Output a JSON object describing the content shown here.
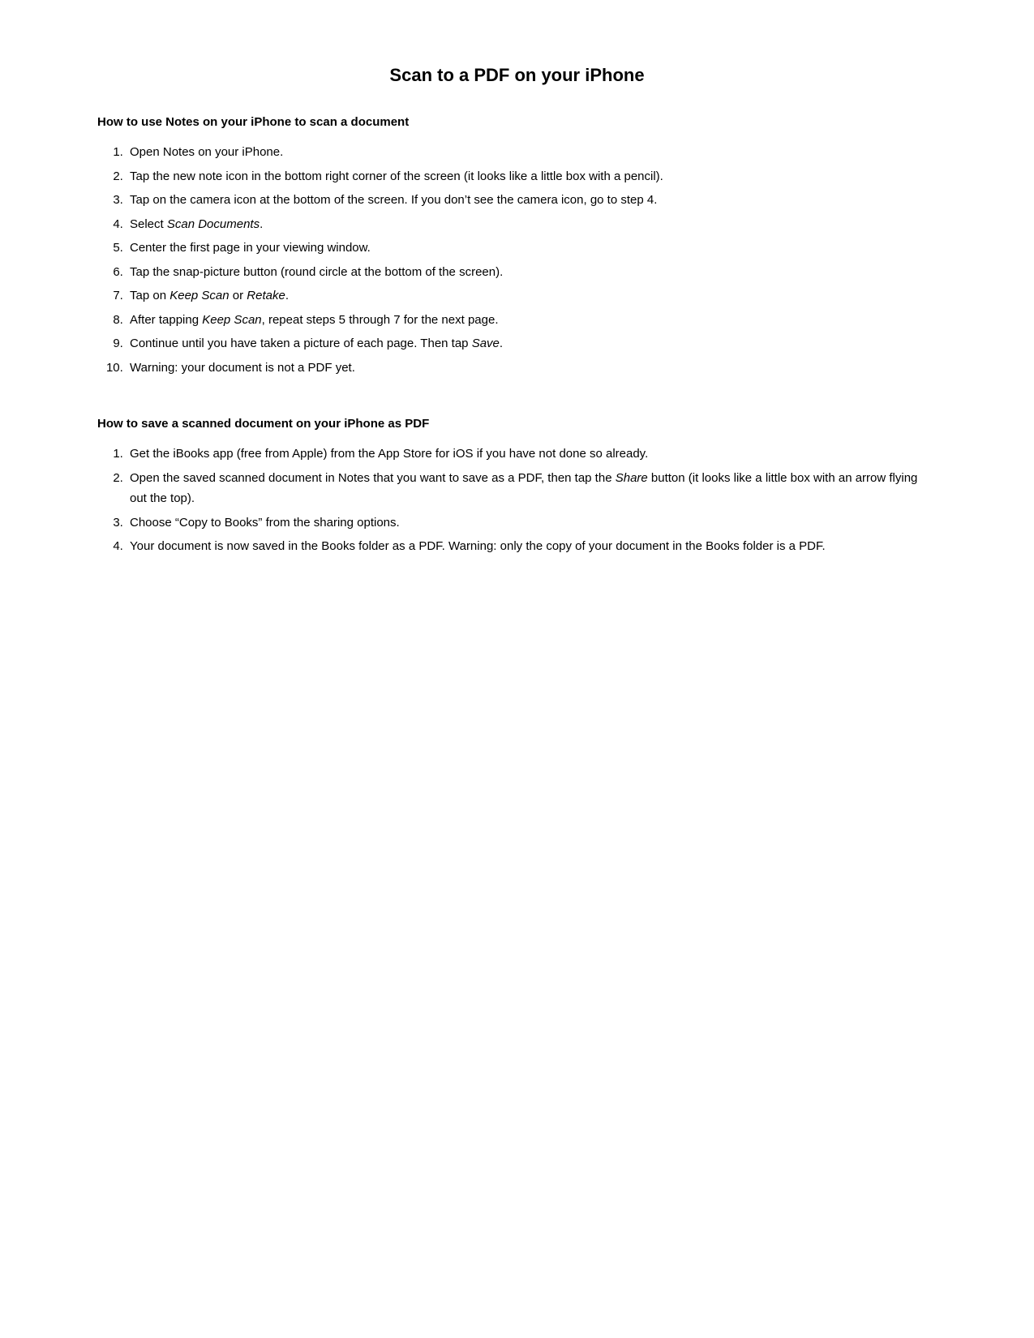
{
  "page": {
    "title": "Scan to a PDF on your iPhone",
    "section1": {
      "heading": "How to use Notes on your iPhone to scan a document",
      "steps": [
        {
          "id": 1,
          "parts": [
            {
              "text": "Open Notes on your iPhone.",
              "italic": false
            }
          ]
        },
        {
          "id": 2,
          "parts": [
            {
              "text": "Tap the new note icon in the bottom right corner of the screen (it looks like a little box with a pencil).",
              "italic": false
            }
          ]
        },
        {
          "id": 3,
          "parts": [
            {
              "text": "Tap on the camera icon at the bottom of the screen. If you don’t see the camera icon, go to step 4.",
              "italic": false
            }
          ]
        },
        {
          "id": 4,
          "parts": [
            {
              "text": "Select ",
              "italic": false
            },
            {
              "text": "Scan Documents",
              "italic": true
            },
            {
              "text": ".",
              "italic": false
            }
          ]
        },
        {
          "id": 5,
          "parts": [
            {
              "text": "Center the first page in your viewing window.",
              "italic": false
            }
          ]
        },
        {
          "id": 6,
          "parts": [
            {
              "text": "Tap the snap-picture button (round circle at the bottom of the screen).",
              "italic": false
            }
          ]
        },
        {
          "id": 7,
          "parts": [
            {
              "text": "Tap on ",
              "italic": false
            },
            {
              "text": "Keep Scan",
              "italic": true
            },
            {
              "text": " or ",
              "italic": false
            },
            {
              "text": "Retake",
              "italic": true
            },
            {
              "text": ".",
              "italic": false
            }
          ]
        },
        {
          "id": 8,
          "parts": [
            {
              "text": "After tapping ",
              "italic": false
            },
            {
              "text": "Keep Scan",
              "italic": true
            },
            {
              "text": ", repeat steps 5 through 7 for the next page.",
              "italic": false
            }
          ]
        },
        {
          "id": 9,
          "parts": [
            {
              "text": "Continue until you have taken a picture of each page. Then tap ",
              "italic": false
            },
            {
              "text": "Save",
              "italic": true
            },
            {
              "text": ".",
              "italic": false
            }
          ]
        },
        {
          "id": 10,
          "parts": [
            {
              "text": "Warning: your document is not a PDF yet.",
              "italic": false
            }
          ]
        }
      ]
    },
    "section2": {
      "heading": "How to save a scanned document on your iPhone as PDF",
      "steps": [
        {
          "id": 1,
          "parts": [
            {
              "text": "Get the iBooks app (free from Apple) from the App Store for iOS if you have not done so already.",
              "italic": false
            }
          ]
        },
        {
          "id": 2,
          "parts": [
            {
              "text": "Open the saved scanned document in Notes that you want to save as a PDF, then tap the ",
              "italic": false
            },
            {
              "text": "Share",
              "italic": true
            },
            {
              "text": " button (it looks like a little box with an arrow flying out the top).",
              "italic": false
            }
          ]
        },
        {
          "id": 3,
          "parts": [
            {
              "text": "Choose “Copy to Books” from the sharing options.",
              "italic": false
            }
          ]
        },
        {
          "id": 4,
          "parts": [
            {
              "text": "Your document is now saved in the Books folder as a PDF. Warning: only the copy of your document in the Books folder is a PDF.",
              "italic": false
            }
          ]
        }
      ]
    }
  }
}
